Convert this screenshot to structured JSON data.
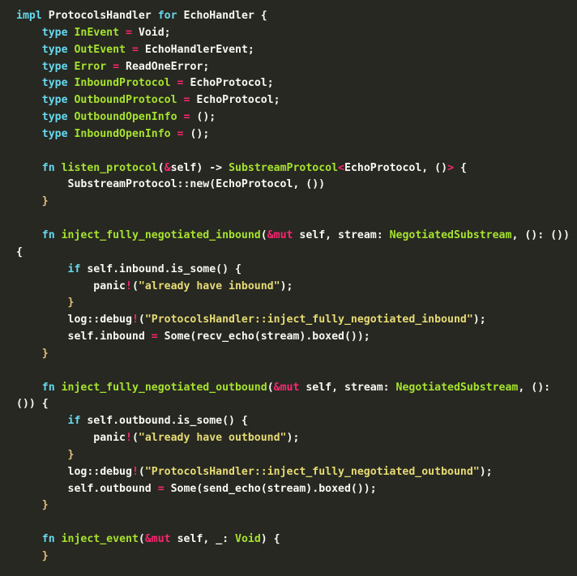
{
  "editor": {
    "language": "rust",
    "theme": "monokai",
    "background_color": "#272822",
    "default_text_color": "#f8f8f2",
    "palette": {
      "keyword": "#66d9ef",
      "function_name": "#a6e22e",
      "type_name": "#a6e22e",
      "operator": "#f92672",
      "string": "#e6db74",
      "plain": "#f8f8f2",
      "brace": "#e6c07b"
    }
  },
  "code": {
    "lines": [
      {
        "id": "line-1",
        "indent": 0,
        "tokens": [
          {
            "t": "impl",
            "c": "kw"
          },
          {
            "t": " ",
            "c": "pl"
          },
          {
            "t": "ProtocolsHandler",
            "c": "pl"
          },
          {
            "t": " ",
            "c": "pl"
          },
          {
            "t": "for",
            "c": "kw"
          },
          {
            "t": " ",
            "c": "pl"
          },
          {
            "t": "EchoHandler",
            "c": "pl"
          },
          {
            "t": " ",
            "c": "pl"
          },
          {
            "t": "{",
            "c": "br"
          }
        ]
      },
      {
        "id": "line-2",
        "indent": 1,
        "tokens": [
          {
            "t": "type",
            "c": "kw"
          },
          {
            "t": " ",
            "c": "pl"
          },
          {
            "t": "InEvent",
            "c": "fnm"
          },
          {
            "t": " ",
            "c": "pl"
          },
          {
            "t": "=",
            "c": "op"
          },
          {
            "t": " ",
            "c": "pl"
          },
          {
            "t": "Void;",
            "c": "pl"
          }
        ]
      },
      {
        "id": "line-3",
        "indent": 1,
        "tokens": [
          {
            "t": "type",
            "c": "kw"
          },
          {
            "t": " ",
            "c": "pl"
          },
          {
            "t": "OutEvent",
            "c": "fnm"
          },
          {
            "t": " ",
            "c": "pl"
          },
          {
            "t": "=",
            "c": "op"
          },
          {
            "t": " ",
            "c": "pl"
          },
          {
            "t": "EchoHandlerEvent;",
            "c": "pl"
          }
        ]
      },
      {
        "id": "line-4",
        "indent": 1,
        "tokens": [
          {
            "t": "type",
            "c": "kw"
          },
          {
            "t": " ",
            "c": "pl"
          },
          {
            "t": "Error",
            "c": "fnm"
          },
          {
            "t": " ",
            "c": "pl"
          },
          {
            "t": "=",
            "c": "op"
          },
          {
            "t": " ",
            "c": "pl"
          },
          {
            "t": "ReadOneError;",
            "c": "pl"
          }
        ]
      },
      {
        "id": "line-5",
        "indent": 1,
        "tokens": [
          {
            "t": "type",
            "c": "kw"
          },
          {
            "t": " ",
            "c": "pl"
          },
          {
            "t": "InboundProtocol",
            "c": "fnm"
          },
          {
            "t": " ",
            "c": "pl"
          },
          {
            "t": "=",
            "c": "op"
          },
          {
            "t": " ",
            "c": "pl"
          },
          {
            "t": "EchoProtocol;",
            "c": "pl"
          }
        ]
      },
      {
        "id": "line-6",
        "indent": 1,
        "tokens": [
          {
            "t": "type",
            "c": "kw"
          },
          {
            "t": " ",
            "c": "pl"
          },
          {
            "t": "OutboundProtocol",
            "c": "fnm"
          },
          {
            "t": " ",
            "c": "pl"
          },
          {
            "t": "=",
            "c": "op"
          },
          {
            "t": " ",
            "c": "pl"
          },
          {
            "t": "EchoProtocol;",
            "c": "pl"
          }
        ]
      },
      {
        "id": "line-7",
        "indent": 1,
        "tokens": [
          {
            "t": "type",
            "c": "kw"
          },
          {
            "t": " ",
            "c": "pl"
          },
          {
            "t": "OutboundOpenInfo",
            "c": "fnm"
          },
          {
            "t": " ",
            "c": "pl"
          },
          {
            "t": "=",
            "c": "op"
          },
          {
            "t": " ",
            "c": "pl"
          },
          {
            "t": "();",
            "c": "pl"
          }
        ]
      },
      {
        "id": "line-8",
        "indent": 1,
        "tokens": [
          {
            "t": "type",
            "c": "kw"
          },
          {
            "t": " ",
            "c": "pl"
          },
          {
            "t": "InboundOpenInfo",
            "c": "fnm"
          },
          {
            "t": " ",
            "c": "pl"
          },
          {
            "t": "=",
            "c": "op"
          },
          {
            "t": " ",
            "c": "pl"
          },
          {
            "t": "();",
            "c": "pl"
          }
        ]
      },
      {
        "id": "line-9",
        "indent": 0,
        "tokens": []
      },
      {
        "id": "line-10",
        "indent": 1,
        "tokens": [
          {
            "t": "fn",
            "c": "kw"
          },
          {
            "t": " ",
            "c": "pl"
          },
          {
            "t": "listen_protocol",
            "c": "fnm"
          },
          {
            "t": "(",
            "c": "pl"
          },
          {
            "t": "&",
            "c": "op"
          },
          {
            "t": "self) -> ",
            "c": "pl"
          },
          {
            "t": "SubstreamProtocol",
            "c": "typ"
          },
          {
            "t": "<",
            "c": "op"
          },
          {
            "t": "EchoProtocol, ()",
            "c": "pl"
          },
          {
            "t": ">",
            "c": "op"
          },
          {
            "t": " {",
            "c": "pl"
          }
        ]
      },
      {
        "id": "line-11",
        "indent": 2,
        "tokens": [
          {
            "t": "SubstreamProtocol::new(EchoProtocol, ())",
            "c": "pl"
          }
        ]
      },
      {
        "id": "line-12",
        "indent": 1,
        "tokens": [
          {
            "t": "}",
            "c": "brc"
          }
        ]
      },
      {
        "id": "line-13",
        "indent": 0,
        "tokens": []
      },
      {
        "id": "line-14",
        "indent": 1,
        "tokens": [
          {
            "t": "fn",
            "c": "kw"
          },
          {
            "t": " ",
            "c": "pl"
          },
          {
            "t": "inject_fully_negotiated_inbound",
            "c": "fnm"
          },
          {
            "t": "(",
            "c": "pl"
          },
          {
            "t": "&",
            "c": "op"
          },
          {
            "t": "mut",
            "c": "mut"
          },
          {
            "t": " self, stream: ",
            "c": "pl"
          },
          {
            "t": "NegotiatedSubstream",
            "c": "typ"
          },
          {
            "t": ", (): ()) {",
            "c": "pl"
          }
        ]
      },
      {
        "id": "line-15",
        "indent": 2,
        "tokens": [
          {
            "t": "if",
            "c": "kw"
          },
          {
            "t": " self.inbound.is_some() {",
            "c": "pl"
          }
        ]
      },
      {
        "id": "line-16",
        "indent": 3,
        "tokens": [
          {
            "t": "panic",
            "c": "pl"
          },
          {
            "t": "!",
            "c": "op"
          },
          {
            "t": "(",
            "c": "pl"
          },
          {
            "t": "\"already have inbound\"",
            "c": "str"
          },
          {
            "t": ");",
            "c": "pl"
          }
        ]
      },
      {
        "id": "line-17",
        "indent": 2,
        "tokens": [
          {
            "t": "}",
            "c": "brc"
          }
        ]
      },
      {
        "id": "line-18",
        "indent": 2,
        "tokens": [
          {
            "t": "log::debug",
            "c": "pl"
          },
          {
            "t": "!",
            "c": "op"
          },
          {
            "t": "(",
            "c": "pl"
          },
          {
            "t": "\"ProtocolsHandler::inject_fully_negotiated_inbound\"",
            "c": "str"
          },
          {
            "t": ");",
            "c": "pl"
          }
        ]
      },
      {
        "id": "line-19",
        "indent": 2,
        "tokens": [
          {
            "t": "self.inbound ",
            "c": "pl"
          },
          {
            "t": "=",
            "c": "op"
          },
          {
            "t": " Some(recv_echo(stream).boxed());",
            "c": "pl"
          }
        ]
      },
      {
        "id": "line-20",
        "indent": 1,
        "tokens": [
          {
            "t": "}",
            "c": "brc"
          }
        ]
      },
      {
        "id": "line-21",
        "indent": 0,
        "tokens": []
      },
      {
        "id": "line-22",
        "indent": 1,
        "tokens": [
          {
            "t": "fn",
            "c": "kw"
          },
          {
            "t": " ",
            "c": "pl"
          },
          {
            "t": "inject_fully_negotiated_outbound",
            "c": "fnm"
          },
          {
            "t": "(",
            "c": "pl"
          },
          {
            "t": "&",
            "c": "op"
          },
          {
            "t": "mut",
            "c": "mut"
          },
          {
            "t": " self, stream: ",
            "c": "pl"
          },
          {
            "t": "NegotiatedSubstream",
            "c": "typ"
          },
          {
            "t": ", (): ()) {",
            "c": "pl"
          }
        ]
      },
      {
        "id": "line-23",
        "indent": 2,
        "tokens": [
          {
            "t": "if",
            "c": "kw"
          },
          {
            "t": " self.outbound.is_some() {",
            "c": "pl"
          }
        ]
      },
      {
        "id": "line-24",
        "indent": 3,
        "tokens": [
          {
            "t": "panic",
            "c": "pl"
          },
          {
            "t": "!",
            "c": "op"
          },
          {
            "t": "(",
            "c": "pl"
          },
          {
            "t": "\"already have outbound\"",
            "c": "str"
          },
          {
            "t": ");",
            "c": "pl"
          }
        ]
      },
      {
        "id": "line-25",
        "indent": 2,
        "tokens": [
          {
            "t": "}",
            "c": "brc"
          }
        ]
      },
      {
        "id": "line-26",
        "indent": 2,
        "tokens": [
          {
            "t": "log::debug",
            "c": "pl"
          },
          {
            "t": "!",
            "c": "op"
          },
          {
            "t": "(",
            "c": "pl"
          },
          {
            "t": "\"ProtocolsHandler::inject_fully_negotiated_outbound\"",
            "c": "str"
          },
          {
            "t": ");",
            "c": "pl"
          }
        ]
      },
      {
        "id": "line-27",
        "indent": 2,
        "tokens": [
          {
            "t": "self.outbound ",
            "c": "pl"
          },
          {
            "t": "=",
            "c": "op"
          },
          {
            "t": " Some(send_echo(stream).boxed());",
            "c": "pl"
          }
        ]
      },
      {
        "id": "line-28",
        "indent": 1,
        "tokens": [
          {
            "t": "}",
            "c": "brc"
          }
        ]
      },
      {
        "id": "line-29",
        "indent": 0,
        "tokens": []
      },
      {
        "id": "line-30",
        "indent": 1,
        "tokens": [
          {
            "t": "fn",
            "c": "kw"
          },
          {
            "t": " ",
            "c": "pl"
          },
          {
            "t": "inject_event",
            "c": "fnm"
          },
          {
            "t": "(",
            "c": "pl"
          },
          {
            "t": "&",
            "c": "op"
          },
          {
            "t": "mut",
            "c": "mut"
          },
          {
            "t": " self, _: ",
            "c": "pl"
          },
          {
            "t": "Void",
            "c": "typ"
          },
          {
            "t": ") {",
            "c": "pl"
          }
        ]
      },
      {
        "id": "line-31",
        "indent": 1,
        "tokens": [
          {
            "t": "}",
            "c": "brc"
          }
        ]
      }
    ]
  }
}
